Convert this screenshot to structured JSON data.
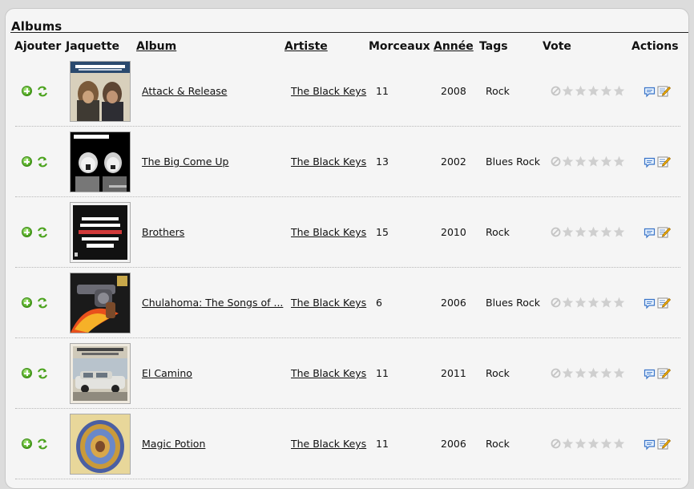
{
  "section_title": "Albums",
  "headers": {
    "add": "Ajouter",
    "cover": "Jaquette",
    "album": "Album",
    "artist": "Artiste",
    "tracks": "Morceaux",
    "year": "Année",
    "tags": "Tags",
    "vote": "Vote",
    "actions": "Actions"
  },
  "rows": [
    {
      "album": "Attack & Release",
      "artist": "The Black Keys",
      "tracks": "11",
      "year": "2008",
      "tags": "Rock",
      "rating": 0
    },
    {
      "album": "The Big Come Up",
      "artist": "The Black Keys",
      "tracks": "13",
      "year": "2002",
      "tags": "Blues Rock",
      "rating": 0
    },
    {
      "album": "Brothers",
      "artist": "The Black Keys",
      "tracks": "15",
      "year": "2010",
      "tags": "Rock",
      "rating": 0
    },
    {
      "album": "Chulahoma: The Songs of ...",
      "artist": "The Black Keys",
      "tracks": "6",
      "year": "2006",
      "tags": "Blues Rock",
      "rating": 0
    },
    {
      "album": "El Camino",
      "artist": "The Black Keys",
      "tracks": "11",
      "year": "2011",
      "tags": "Rock",
      "rating": 0
    },
    {
      "album": "Magic Potion",
      "artist": "The Black Keys",
      "tracks": "11",
      "year": "2006",
      "tags": "Rock",
      "rating": 0
    }
  ],
  "icons": {
    "add": "add-to-playlist-icon",
    "play": "play-random-icon",
    "no_rating": "no-rating-icon",
    "star": "star-icon",
    "comment": "comment-icon",
    "edit": "edit-icon"
  },
  "colors": {
    "link": "#111111",
    "star_empty": "#cfcfcf",
    "add_green": "#4aa21c"
  }
}
